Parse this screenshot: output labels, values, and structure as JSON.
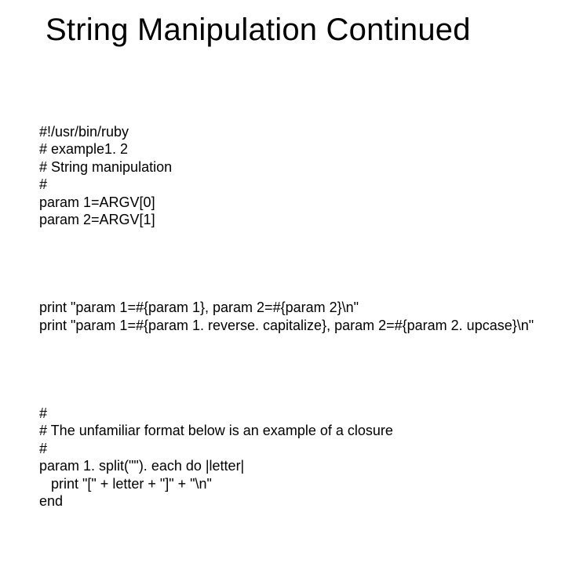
{
  "title": "String Manipulation Continued",
  "code": {
    "l1": "#!/usr/bin/ruby",
    "l2": "# example1. 2",
    "l3": "# String manipulation",
    "l4": "#",
    "l5": "param 1=ARGV[0]",
    "l6": "param 2=ARGV[1]",
    "l7": "print \"param 1=#{param 1}, param 2=#{param 2}\\n\"",
    "l8": "print \"param 1=#{param 1. reverse. capitalize}, param 2=#{param 2. upcase}\\n\"",
    "l9": "#",
    "l10": "# The unfamiliar format below is an example of a closure",
    "l11": "#",
    "l12": "param 1. split(\"\"). each do |letter|",
    "l13": "   print \"[\" + letter + \"]\" + \"\\n\"",
    "l14": "end"
  }
}
